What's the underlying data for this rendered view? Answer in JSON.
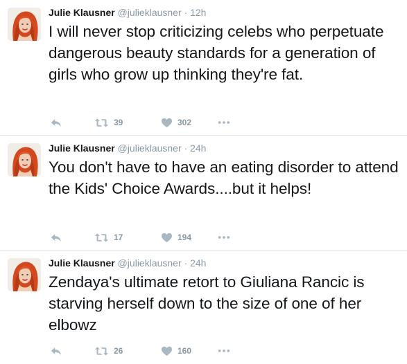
{
  "tweets": [
    {
      "name": "Julie Klausner",
      "handle": "@julieklausner",
      "separator": "·",
      "time": "12h",
      "text": "I will never stop criticizing celebs who perpetuate dangerous beauty standards for a generation of girls who grow up thinking they're fat.",
      "retweets": "39",
      "likes": "302"
    },
    {
      "name": "Julie Klausner",
      "handle": "@julieklausner",
      "separator": "·",
      "time": "24h",
      "text": "You don't have to have an eating disorder to attend the Kids' Choice Awards....but it helps!",
      "retweets": "17",
      "likes": "194"
    },
    {
      "name": "Julie Klausner",
      "handle": "@julieklausner",
      "separator": "·",
      "time": "24h",
      "text": "Zendaya's ultimate retort to Giuliana Rancic is starving herself down to the size of one of her elbowz",
      "retweets": "26",
      "likes": "160"
    }
  ],
  "icons": {
    "reply": "reply-icon",
    "retweet": "retweet-icon",
    "like": "heart-icon",
    "more": "more-icon"
  },
  "colors": {
    "text": "#14171a",
    "muted": "#8899a6",
    "icon": "#aab8c2",
    "divider": "#e1e8ed",
    "avatar_hair": "#d2491f"
  }
}
